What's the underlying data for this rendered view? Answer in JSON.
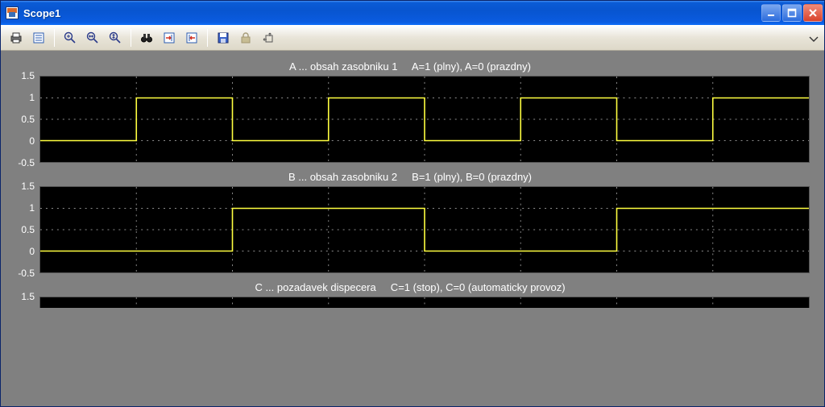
{
  "window": {
    "title": "Scope1"
  },
  "toolbar": {
    "print": "print",
    "params": "parameters",
    "zoom_in": "zoom-in",
    "zoom_x": "zoom-x",
    "zoom_y": "zoom-y",
    "find": "binoculars",
    "autoscale_left": "autoscale-left",
    "autoscale_right": "autoscale-right",
    "save": "save-settings",
    "lock": "lock",
    "float": "float"
  },
  "charts": [
    {
      "title": "A ... obsah zasobniku 1     A=1 (plny), A=0 (prazdny)"
    },
    {
      "title": "B ... obsah zasobniku 2     B=1 (plny), B=0 (prazdny)"
    },
    {
      "title": "C ... pozadavek dispecera     C=1 (stop), C=0 (automaticky provoz)"
    }
  ],
  "yticks": [
    "1.5",
    "1",
    "0.5",
    "0",
    "-0.5"
  ],
  "chart_data": [
    {
      "type": "line",
      "title": "A ... obsah zasobniku 1     A=1 (plny), A=0 (prazdny)",
      "xlabel": "",
      "ylabel": "",
      "ylim": [
        -0.5,
        1.5
      ],
      "x": [
        0,
        2,
        2,
        4,
        4,
        6,
        6,
        8,
        8,
        10,
        10,
        12,
        12,
        14,
        14,
        16
      ],
      "values": [
        0,
        0,
        1,
        1,
        0,
        0,
        1,
        1,
        0,
        0,
        1,
        1,
        0,
        0,
        1,
        1
      ]
    },
    {
      "type": "line",
      "title": "B ... obsah zasobniku 2     B=1 (plny), B=0 (prazdny)",
      "xlabel": "",
      "ylabel": "",
      "ylim": [
        -0.5,
        1.5
      ],
      "x": [
        0,
        4,
        4,
        8,
        8,
        12,
        12,
        16
      ],
      "values": [
        0,
        0,
        1,
        1,
        0,
        0,
        1,
        1
      ]
    },
    {
      "type": "line",
      "title": "C ... pozadavek dispecera     C=1 (stop), C=0 (automaticky provoz)",
      "xlabel": "",
      "ylabel": "",
      "ylim": [
        -0.5,
        1.5
      ],
      "x": [],
      "values": []
    }
  ]
}
